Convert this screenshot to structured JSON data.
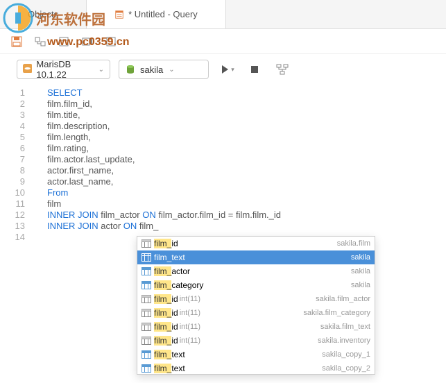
{
  "tabs": {
    "objects": "Objects",
    "query": "* Untitled - Query"
  },
  "conn": {
    "connection": "MarisDB 10.1.22",
    "database": "sakila"
  },
  "code": {
    "lines": [
      {
        "n": "1",
        "t": [
          {
            "c": "kw",
            "s": "SELECT"
          }
        ]
      },
      {
        "n": "2",
        "t": [
          {
            "c": "plain",
            "s": "film.film_id,"
          }
        ]
      },
      {
        "n": "3",
        "t": [
          {
            "c": "plain",
            "s": "film.title,"
          }
        ]
      },
      {
        "n": "4",
        "t": [
          {
            "c": "plain",
            "s": "film.description,"
          }
        ]
      },
      {
        "n": "5",
        "t": [
          {
            "c": "plain",
            "s": "film.length,"
          }
        ]
      },
      {
        "n": "6",
        "t": [
          {
            "c": "plain",
            "s": "film.rating,"
          }
        ]
      },
      {
        "n": "7",
        "t": [
          {
            "c": "plain",
            "s": "film.actor.last_update,"
          }
        ]
      },
      {
        "n": "8",
        "t": [
          {
            "c": "plain",
            "s": "actor.first_name,"
          }
        ]
      },
      {
        "n": "9",
        "t": [
          {
            "c": "plain",
            "s": "actor.last_name,"
          }
        ]
      },
      {
        "n": "10",
        "t": [
          {
            "c": "kw",
            "s": "From"
          }
        ]
      },
      {
        "n": "11",
        "t": [
          {
            "c": "plain",
            "s": "film"
          }
        ]
      },
      {
        "n": "12",
        "t": [
          {
            "c": "kw",
            "s": "INNER JOIN"
          },
          {
            "c": "plain",
            "s": " film_actor "
          },
          {
            "c": "kw",
            "s": "ON"
          },
          {
            "c": "plain",
            "s": " film_actor.film_id = film.film._id"
          }
        ]
      },
      {
        "n": "13",
        "t": [
          {
            "c": "kw",
            "s": "INNER JOIN"
          },
          {
            "c": "plain",
            "s": " actor "
          },
          {
            "c": "kw",
            "s": "ON"
          },
          {
            "c": "plain",
            "s": " film_"
          }
        ]
      },
      {
        "n": "14",
        "t": []
      }
    ]
  },
  "autocomplete": {
    "items": [
      {
        "kind": "col",
        "name": "film_id",
        "hl": "film_",
        "type": "",
        "schema": "sakila.film",
        "sel": false
      },
      {
        "kind": "tbl",
        "name": "film_text",
        "hl": "film_",
        "type": "",
        "schema": "sakila",
        "sel": true
      },
      {
        "kind": "tbl",
        "name": "film_actor",
        "hl": "film_",
        "type": "",
        "schema": "sakila",
        "sel": false
      },
      {
        "kind": "tbl",
        "name": "film_category",
        "hl": "film_",
        "type": "",
        "schema": "sakila",
        "sel": false
      },
      {
        "kind": "col",
        "name": "film_id",
        "hl": "film_",
        "type": "int(11)",
        "schema": "sakila.film_actor",
        "sel": false
      },
      {
        "kind": "col",
        "name": "film_id",
        "hl": "film_",
        "type": "int(11)",
        "schema": "sakila.film_category",
        "sel": false
      },
      {
        "kind": "col",
        "name": "film_id",
        "hl": "film_",
        "type": "int(11)",
        "schema": "sakila.film_text",
        "sel": false
      },
      {
        "kind": "col",
        "name": "film_id",
        "hl": "film_",
        "type": "int(11)",
        "schema": "sakila.inventory",
        "sel": false
      },
      {
        "kind": "tbl",
        "name": "film_text",
        "hl": "film_",
        "type": "",
        "schema": "sakila_copy_1",
        "sel": false
      },
      {
        "kind": "tbl",
        "name": "film_text",
        "hl": "film_",
        "type": "",
        "schema": "sakila_copy_2",
        "sel": false
      }
    ]
  },
  "watermark": {
    "title": "河东软件园",
    "url": "www.pc0359.cn"
  }
}
